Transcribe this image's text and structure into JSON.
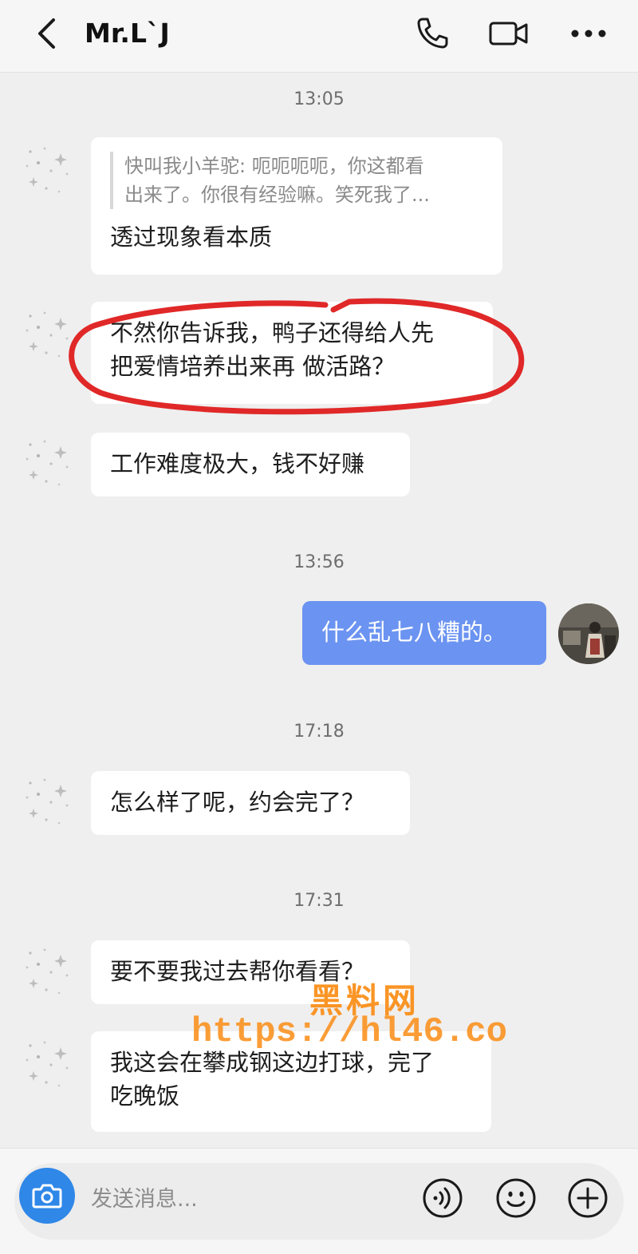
{
  "header": {
    "contact_name": "Mr.L`J"
  },
  "messages": [
    {
      "type": "time",
      "text": "13:05"
    },
    {
      "type": "peer",
      "quote": "快叫我小羊驼: 呃呃呃呃，你这都看出来了。你很有经验嘛。笑死我了...",
      "text": "透过现象看本质"
    },
    {
      "type": "peer",
      "text": "不然你告诉我，鸭子还得给人先把爱情培养出来再 做活路？",
      "annotation": "red-circle"
    },
    {
      "type": "peer",
      "text": "工作难度极大，钱不好赚"
    },
    {
      "type": "time",
      "text": "13:56"
    },
    {
      "type": "self",
      "text": "什么乱七八糟的。"
    },
    {
      "type": "time",
      "text": "17:18"
    },
    {
      "type": "peer",
      "text": "怎么样了呢，约会完了？"
    },
    {
      "type": "time",
      "text": "17:31"
    },
    {
      "type": "peer",
      "text": "要不要我过去帮你看看？"
    },
    {
      "type": "peer",
      "text": "我这会在攀成钢这边打球，完了吃晚饭"
    }
  ],
  "quote_lines": [
    "快叫我小羊驼: 呃呃呃呃，你这都看",
    "出来了。你很有经验嘛。笑死我了..."
  ],
  "red_circle_lines": [
    "不然你告诉我，鸭子还得给人先",
    "把爱情培养出来再 做活路？"
  ],
  "last_lines": [
    "我这会在攀成钢这边打球，完了",
    "吃晚饭"
  ],
  "watermark": {
    "line1": "黑料网",
    "line2": "https://hl46.co"
  },
  "input": {
    "placeholder": "发送消息..."
  },
  "icons": {
    "back": "chevron-left-icon",
    "call": "phone-icon",
    "video": "video-camera-icon",
    "more": "more-dots-icon",
    "camera": "camera-icon",
    "voice": "voice-icon",
    "emoji": "smiley-icon",
    "add": "plus-icon"
  },
  "colors": {
    "self_bubble": "#6b93f1",
    "camera_button": "#2f87e8",
    "annotation": "#e02828",
    "watermark": "#fa8c14"
  }
}
